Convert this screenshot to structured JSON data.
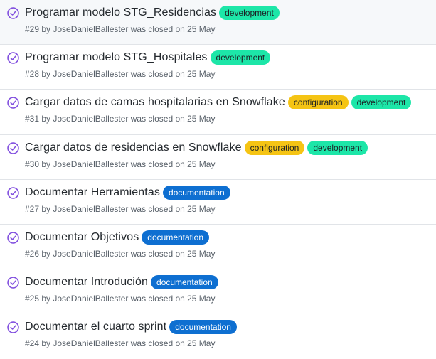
{
  "colors": {
    "closed_icon": "#8250df",
    "development": "#1de6a8",
    "configuration": "#f5c414",
    "documentation": "#0e6fd1"
  },
  "issues": [
    {
      "title": "Programar modelo STG_Residencias",
      "labels": [
        {
          "text": "development",
          "kind": "development"
        }
      ],
      "meta": "#29 by JoseDanielBallester was closed on 25 May"
    },
    {
      "title": "Programar modelo STG_Hospitales",
      "labels": [
        {
          "text": "development",
          "kind": "development"
        }
      ],
      "meta": "#28 by JoseDanielBallester was closed on 25 May"
    },
    {
      "title": "Cargar datos de camas hospitalarias en Snowflake",
      "labels": [
        {
          "text": "configuration",
          "kind": "configuration"
        },
        {
          "text": "development",
          "kind": "development"
        }
      ],
      "meta": "#31 by JoseDanielBallester was closed on 25 May"
    },
    {
      "title": "Cargar datos de residencias en Snowflake",
      "labels": [
        {
          "text": "configuration",
          "kind": "configuration"
        },
        {
          "text": "development",
          "kind": "development"
        }
      ],
      "meta": "#30 by JoseDanielBallester was closed on 25 May"
    },
    {
      "title": "Documentar Herramientas",
      "labels": [
        {
          "text": "documentation",
          "kind": "documentation"
        }
      ],
      "meta": "#27 by JoseDanielBallester was closed on 25 May"
    },
    {
      "title": "Documentar Objetivos",
      "labels": [
        {
          "text": "documentation",
          "kind": "documentation"
        }
      ],
      "meta": "#26 by JoseDanielBallester was closed on 25 May"
    },
    {
      "title": "Documentar Introdución",
      "labels": [
        {
          "text": "documentation",
          "kind": "documentation"
        }
      ],
      "meta": "#25 by JoseDanielBallester was closed on 25 May"
    },
    {
      "title": "Documentar el cuarto sprint",
      "labels": [
        {
          "text": "documentation",
          "kind": "documentation"
        }
      ],
      "meta": "#24 by JoseDanielBallester was closed on 25 May"
    }
  ]
}
